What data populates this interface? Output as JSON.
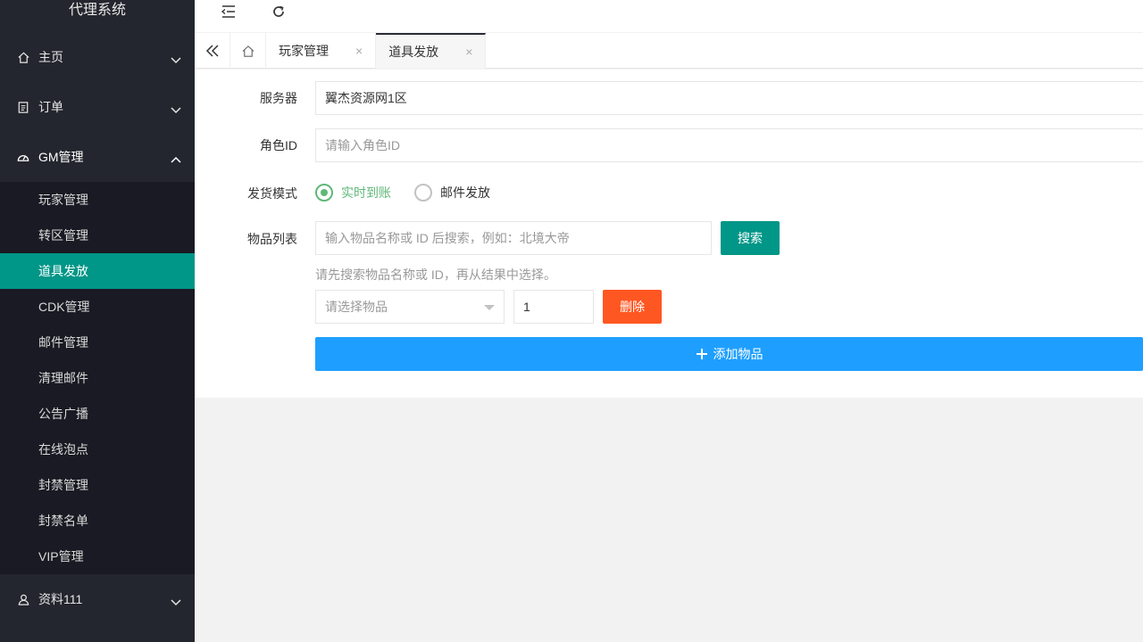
{
  "app_title": "代理系统",
  "colors": {
    "sidebar_bg": "#23262e",
    "submenu_bg": "#191a23",
    "active_green": "#009688",
    "radio_green": "#5fb878",
    "delete_red": "#ff5722",
    "add_blue": "#1e9fff"
  },
  "sidebar": {
    "groups": [
      {
        "label": "主页",
        "icon": "home-icon"
      },
      {
        "label": "订单",
        "icon": "clipboard-icon"
      },
      {
        "label": "GM管理",
        "icon": "dashboard-icon"
      }
    ],
    "gm_items": [
      "玩家管理",
      "转区管理",
      "道具发放",
      "CDK管理",
      "邮件管理",
      "清理邮件",
      "公告广播",
      "在线泡点",
      "封禁管理",
      "封禁名单",
      "VIP管理"
    ],
    "active_item": "道具发放",
    "bottom_group": {
      "label": "资料111",
      "icon": "user-icon"
    }
  },
  "header": {
    "toggle_icon": "menu-fold-icon",
    "refresh_icon": "refresh-icon"
  },
  "tabs": {
    "items": [
      {
        "label": "玩家管理",
        "close": "×"
      },
      {
        "label": "道具发放",
        "close": "×"
      }
    ],
    "active": "道具发放"
  },
  "form": {
    "server_label": "服务器",
    "server_value": "翼杰资源网1区",
    "role_label": "角色ID",
    "role_placeholder": "请输入角色ID",
    "mode_label": "发货模式",
    "mode_options": [
      "实时到账",
      "邮件发放"
    ],
    "mode_selected": "实时到账",
    "items_label": "物品列表",
    "search_placeholder": "输入物品名称或 ID 后搜索，例如：北境大帝",
    "search_button": "搜索",
    "hint": "请先搜索物品名称或 ID，再从结果中选择。",
    "item_select_placeholder": "请选择物品",
    "quantity": "1",
    "delete_button": "删除",
    "add_button": "添加物品"
  }
}
